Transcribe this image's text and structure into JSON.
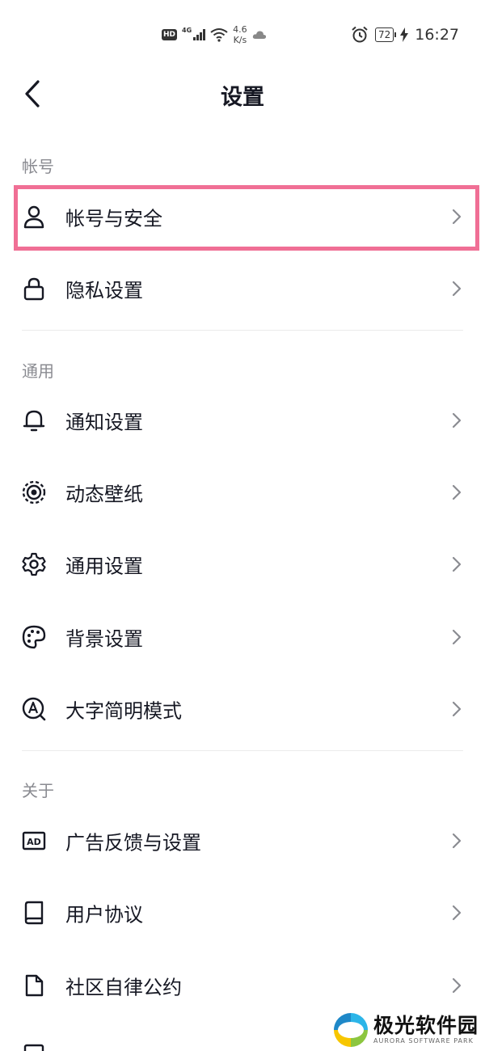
{
  "status_bar": {
    "hd": "HD",
    "network": "4G",
    "speed_value": "4.6",
    "speed_unit": "K/s",
    "battery": "72",
    "time": "16:27"
  },
  "nav": {
    "title": "设置"
  },
  "sections": {
    "account": {
      "header": "帐号",
      "items": [
        {
          "label": "帐号与安全",
          "icon": "user-icon"
        },
        {
          "label": "隐私设置",
          "icon": "lock-icon"
        }
      ]
    },
    "general": {
      "header": "通用",
      "items": [
        {
          "label": "通知设置",
          "icon": "bell-icon"
        },
        {
          "label": "动态壁纸",
          "icon": "live-wallpaper-icon"
        },
        {
          "label": "通用设置",
          "icon": "gear-icon"
        },
        {
          "label": "背景设置",
          "icon": "palette-icon"
        },
        {
          "label": "大字简明模式",
          "icon": "large-font-icon"
        }
      ]
    },
    "about": {
      "header": "关于",
      "items": [
        {
          "label": "广告反馈与设置",
          "icon": "ad-icon"
        },
        {
          "label": "用户协议",
          "icon": "book-icon"
        },
        {
          "label": "社区自律公约",
          "icon": "document-icon"
        }
      ]
    }
  },
  "colors": {
    "highlight": "#f06f95",
    "text_primary": "#161823",
    "text_secondary": "#8a8b91",
    "divider": "#ebebeb"
  },
  "watermark": {
    "title": "极光软件园",
    "subtitle": "AURORA SOFTWARE PARK"
  }
}
